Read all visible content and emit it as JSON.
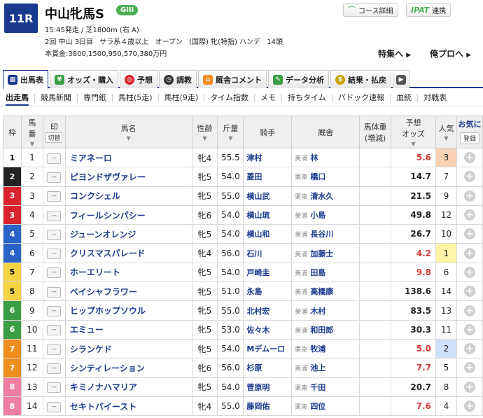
{
  "race": {
    "number": "11R",
    "name": "中山牝馬S",
    "grade": "GIII",
    "start_info": "15:45発走 / 芝1800m (右 A)",
    "detail": [
      "2回 中山 3日目",
      "サラ系４歳以上",
      "オープン",
      "(国際) 牝(特指) ハンデ",
      "14頭"
    ],
    "prize": "本賞金:3800,1500,950,570,380万円"
  },
  "header_buttons": {
    "course": "コース詳細",
    "ipat": "IPAT",
    "ipat_suffix": "連携"
  },
  "nav": {
    "prev": "特集へ",
    "next": "俺プロへ"
  },
  "tabs": [
    {
      "label": "出馬表",
      "icon": "table-icon",
      "color": "#1a3a8f"
    },
    {
      "label": "オッズ・購入",
      "icon": "ticket-icon",
      "color": "#3b9e44"
    },
    {
      "label": "予想",
      "icon": "target-icon",
      "color": "#d9232d"
    },
    {
      "label": "調教",
      "icon": "stopwatch-icon",
      "color": "#333333"
    },
    {
      "label": "厩舎コメント",
      "icon": "stable-icon",
      "color": "#ef8d1e"
    },
    {
      "label": "データ分析",
      "icon": "chart-icon",
      "color": "#3b9e44"
    },
    {
      "label": "結果・払戻",
      "icon": "coin-icon",
      "color": "#c8a000"
    }
  ],
  "subtabs": [
    "出走馬",
    "競馬新聞",
    "専門紙",
    "馬柱(5走)",
    "馬柱(9走)",
    "タイム指数",
    "メモ",
    "持ちタイム",
    "パドック速報",
    "血統",
    "対戦表"
  ],
  "columns": {
    "waku": "枠",
    "umaban_1": "馬",
    "umaban_2": "番",
    "mark": "印",
    "mark_btn": "切替",
    "horse": "馬名",
    "sexage": "性齢",
    "weight": "斤量",
    "jockey": "騎手",
    "stable": "厩舎",
    "bodyweight_1": "馬体重",
    "bodyweight_2": "(増減)",
    "odds_1": "予想",
    "odds_2": "オッズ",
    "pop": "人気",
    "fav_1": "お気に",
    "fav_btn": "登録"
  },
  "mark_placeholder": "--",
  "horses": [
    {
      "waku": "1",
      "umaban": "1",
      "name": "ミアネーロ",
      "sexage": "牝4",
      "weight": "55.5",
      "jockey": "津村",
      "region": "美浦",
      "trainer": "林",
      "odds": "5.6",
      "pop": "3"
    },
    {
      "waku": "2",
      "umaban": "2",
      "name": "ピヨンドザヴァレー",
      "sexage": "牝5",
      "weight": "54.0",
      "jockey": "菱田",
      "region": "栗東",
      "trainer": "橋口",
      "odds": "14.7",
      "pop": "7"
    },
    {
      "waku": "3",
      "umaban": "3",
      "name": "コンクシェル",
      "sexage": "牝5",
      "weight": "55.0",
      "jockey": "横山武",
      "region": "栗東",
      "trainer": "清水久",
      "odds": "21.5",
      "pop": "9"
    },
    {
      "waku": "3",
      "umaban": "4",
      "name": "フィールシンパシー",
      "sexage": "牝6",
      "weight": "54.0",
      "jockey": "横山琉",
      "region": "美浦",
      "trainer": "小島",
      "odds": "49.8",
      "pop": "12"
    },
    {
      "waku": "4",
      "umaban": "5",
      "name": "ジューンオレンジ",
      "sexage": "牝5",
      "weight": "54.0",
      "jockey": "横山和",
      "region": "美浦",
      "trainer": "長谷川",
      "odds": "26.7",
      "pop": "10"
    },
    {
      "waku": "4",
      "umaban": "6",
      "name": "クリスマスパレード",
      "sexage": "牝4",
      "weight": "56.0",
      "jockey": "石川",
      "region": "美浦",
      "trainer": "加藤士",
      "odds": "4.2",
      "pop": "1"
    },
    {
      "waku": "5",
      "umaban": "7",
      "name": "ホーエリート",
      "sexage": "牝5",
      "weight": "54.0",
      "jockey": "戸崎圭",
      "region": "美浦",
      "trainer": "田島",
      "odds": "9.8",
      "pop": "6"
    },
    {
      "waku": "5",
      "umaban": "8",
      "name": "ベイシャフラワー",
      "sexage": "牝5",
      "weight": "51.0",
      "jockey": "永島",
      "region": "美浦",
      "trainer": "高橋康",
      "odds": "138.6",
      "pop": "14"
    },
    {
      "waku": "6",
      "umaban": "9",
      "name": "ヒップホップソウル",
      "sexage": "牝5",
      "weight": "55.0",
      "jockey": "北村宏",
      "region": "美浦",
      "trainer": "木村",
      "odds": "83.5",
      "pop": "13"
    },
    {
      "waku": "6",
      "umaban": "10",
      "name": "エミュー",
      "sexage": "牝5",
      "weight": "53.0",
      "jockey": "佐々木",
      "region": "美浦",
      "trainer": "和田郎",
      "odds": "30.3",
      "pop": "11"
    },
    {
      "waku": "7",
      "umaban": "11",
      "name": "シランケド",
      "sexage": "牝5",
      "weight": "54.0",
      "jockey": "Mデムーロ",
      "region": "栗東",
      "trainer": "牧浦",
      "odds": "5.0",
      "pop": "2"
    },
    {
      "waku": "7",
      "umaban": "12",
      "name": "シンティレーション",
      "sexage": "牝6",
      "weight": "56.0",
      "jockey": "杉原",
      "region": "美浦",
      "trainer": "池上",
      "odds": "7.7",
      "pop": "5"
    },
    {
      "waku": "8",
      "umaban": "13",
      "name": "キミノナハマリア",
      "sexage": "牝5",
      "weight": "54.0",
      "jockey": "菅原明",
      "region": "栗東",
      "trainer": "千田",
      "odds": "20.7",
      "pop": "8"
    },
    {
      "waku": "8",
      "umaban": "14",
      "name": "セキトバイースト",
      "sexage": "牝4",
      "weight": "55.0",
      "jockey": "藤岡佑",
      "region": "栗東",
      "trainer": "四位",
      "odds": "7.6",
      "pop": "4"
    }
  ]
}
